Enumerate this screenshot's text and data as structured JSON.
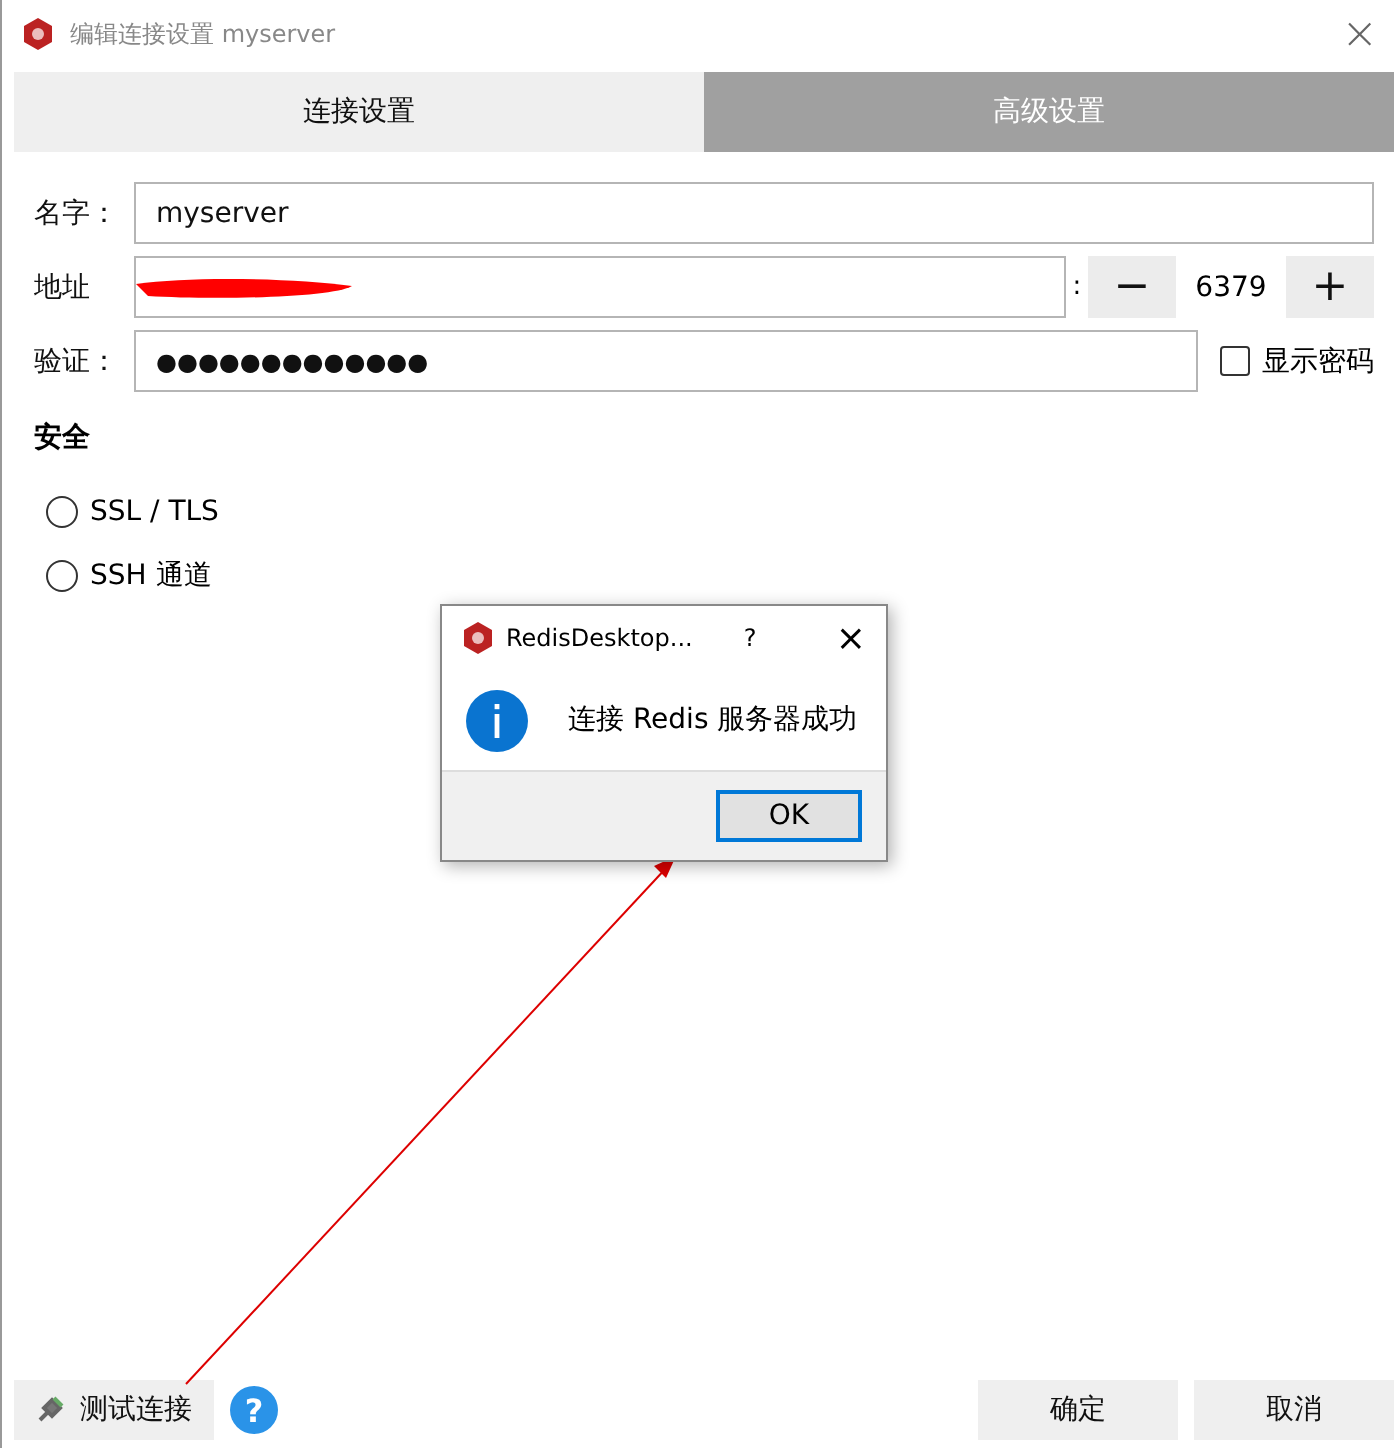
{
  "window": {
    "title": "编辑连接设置 myserver",
    "close": "×"
  },
  "tabs": [
    {
      "label": "连接设置",
      "selected": true
    },
    {
      "label": "高级设置",
      "selected": false
    }
  ],
  "form": {
    "name_label": "名字：",
    "name_value": "myserver",
    "address_label": "地址",
    "address_redacted": true,
    "port_separator": ":",
    "port_minus": "−",
    "port_value": "6379",
    "port_plus": "+",
    "auth_label": "验证：",
    "auth_value": "●●●●●●●●●●●●●",
    "show_password": {
      "label": "显示密码",
      "checked": false
    }
  },
  "security": {
    "title": "安全",
    "options": [
      {
        "label": "SSL / TLS",
        "selected": false
      },
      {
        "label": "SSH 通道",
        "selected": false
      }
    ]
  },
  "dialog": {
    "title": "RedisDesktop...",
    "help": "?",
    "close": "×",
    "message": "连接 Redis 服务器成功",
    "ok": "OK"
  },
  "footer": {
    "test_button": "测试连接",
    "help": "?",
    "ok": "确定",
    "cancel": "取消"
  }
}
